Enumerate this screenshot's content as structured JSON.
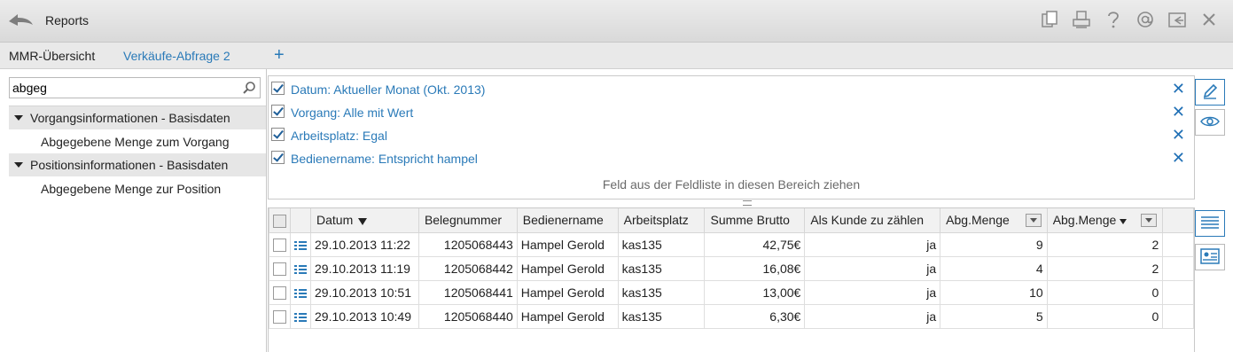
{
  "app": {
    "title": "Reports"
  },
  "tabs": [
    {
      "label": "MMR-Übersicht"
    },
    {
      "label": "Verkäufe-Abfrage 2"
    }
  ],
  "tab_add_label": "+",
  "search": {
    "value": "abgeg"
  },
  "tree": [
    {
      "label": "Vorgangsinformationen - Basisdaten",
      "children": [
        "Abgegebene Menge zum Vorgang"
      ]
    },
    {
      "label": "Positionsinformationen - Basisdaten",
      "children": [
        "Abgegebene Menge zur Position"
      ]
    }
  ],
  "filters": [
    {
      "label": "Datum: Aktueller Monat   (Okt. 2013)",
      "checked": true
    },
    {
      "label": "Vorgang: Alle mit Wert",
      "checked": true
    },
    {
      "label": "Arbeitsplatz: Egal",
      "checked": true
    },
    {
      "label": "Bedienername: Entspricht hampel",
      "checked": true
    }
  ],
  "filter_remove_glyph": "✕",
  "drop_hint": "Feld aus der Feldliste in diesen Bereich ziehen",
  "table": {
    "columns": [
      "Datum",
      "Belegnummer",
      "Bedienername",
      "Arbeitsplatz",
      "Summe Brutto",
      "Als Kunde zu zählen",
      "Abg.Menge",
      "Abg.Menge"
    ],
    "rows": [
      [
        "29.10.2013 11:22",
        "1205068443",
        "Hampel Gerold",
        "kas135",
        "42,75€",
        "ja",
        "9",
        "2"
      ],
      [
        "29.10.2013 11:19",
        "1205068442",
        "Hampel Gerold",
        "kas135",
        "16,08€",
        "ja",
        "4",
        "2"
      ],
      [
        "29.10.2013 10:51",
        "1205068441",
        "Hampel Gerold",
        "kas135",
        "13,00€",
        "ja",
        "10",
        "0"
      ],
      [
        "29.10.2013 10:49",
        "1205068440",
        "Hampel Gerold",
        "kas135",
        "6,30€",
        "ja",
        "5",
        "0"
      ]
    ]
  },
  "colors": {
    "accent": "#2a7ab8",
    "remove": "#1f6fb5",
    "icon_gray": "#8a8a8a"
  },
  "icons": [
    "back-arrow-icon",
    "copy-icon",
    "print-icon",
    "help-icon",
    "email-icon",
    "export-icon",
    "close-icon",
    "pencil-icon",
    "eye-icon",
    "list-view-icon",
    "card-view-icon",
    "search-icon",
    "detail-icon"
  ]
}
